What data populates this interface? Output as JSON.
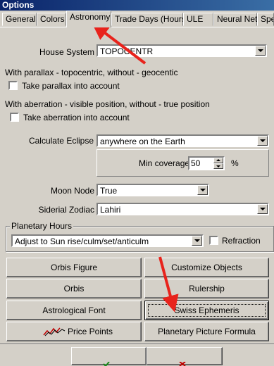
{
  "window": {
    "title": "Options"
  },
  "tabs": [
    {
      "label": "General"
    },
    {
      "label": "Colors"
    },
    {
      "label": "Astronomy",
      "active": true
    },
    {
      "label": "Trade Days (Hours)"
    },
    {
      "label": "ULE"
    },
    {
      "label": "Neural Net"
    },
    {
      "label": "Spe"
    }
  ],
  "house_system": {
    "label": "House System",
    "value": "TOPOCENTR"
  },
  "parallax": {
    "description": "With parallax - topocentric, without - geocentic",
    "checkbox_label": "Take parallax into account",
    "checked": false
  },
  "aberration": {
    "description": "With aberration - visible position, without - true position",
    "checkbox_label": "Take aberration into account",
    "checked": false
  },
  "eclipse": {
    "label": "Calculate Eclipse",
    "value": "anywhere on the Earth",
    "min_coverage_label": "Min coverage",
    "min_coverage_value": "50",
    "unit": "%"
  },
  "moon_node": {
    "label": "Moon Node",
    "value": "True"
  },
  "sidereal_zodiac": {
    "label": "Siderial Zodiac",
    "value": "Lahiri"
  },
  "planetary_hours": {
    "group_label": "Planetary Hours",
    "value": "Adjust to Sun rise/culm/set/anticulm",
    "refraction_label": "Refraction",
    "refraction_checked": false
  },
  "buttons": {
    "orbis_figure": "Orbis Figure",
    "customize_objects": "Customize Objects",
    "orbis": "Orbis",
    "rulership": "Rulership",
    "astrological_font": "Astrological Font",
    "swiss_ephemeris": "Swiss Ephemeris",
    "price_points": "Price Points",
    "planetary_picture_formula": "Planetary Picture Formula"
  },
  "colors": {
    "annotation_arrow": "#e8231c",
    "title_bar": "#0a246a",
    "face": "#d4d0c8"
  }
}
